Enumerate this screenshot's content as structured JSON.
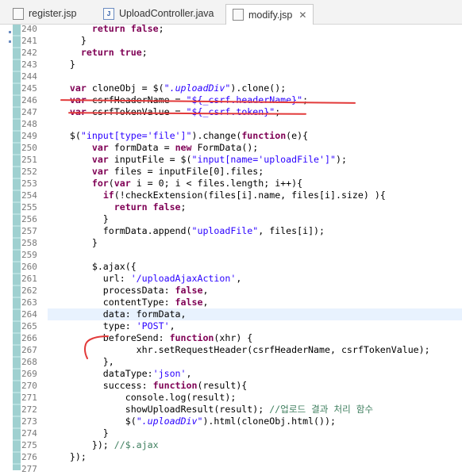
{
  "tabs": [
    {
      "label": "register.jsp",
      "icon": "jsp-file-icon",
      "active": false
    },
    {
      "label": "UploadController.java",
      "icon": "java-file-icon",
      "active": false
    },
    {
      "label": "modify.jsp",
      "icon": "jsp-file-icon",
      "active": true
    }
  ],
  "close_glyph": "✕",
  "colors": {
    "keyword": "#7f0055",
    "string": "#2a00ff",
    "comment": "#3f7f5f",
    "annotation": "#e23a3a",
    "current_line": "#e8f2fe"
  },
  "lines": [
    {
      "n": "240",
      "tokens": [
        [
          "",
          "        "
        ],
        [
          "kw",
          "return"
        ],
        [
          "",
          " "
        ],
        [
          "kw",
          "false"
        ],
        [
          "",
          ";"
        ]
      ]
    },
    {
      "n": "241",
      "tokens": [
        [
          "",
          "      }"
        ]
      ]
    },
    {
      "n": "242",
      "tokens": [
        [
          "",
          "      "
        ],
        [
          "kw",
          "return"
        ],
        [
          "",
          " "
        ],
        [
          "kw",
          "true"
        ],
        [
          "",
          ";"
        ]
      ]
    },
    {
      "n": "243",
      "tokens": [
        [
          "",
          "    }"
        ]
      ]
    },
    {
      "n": "244",
      "tokens": [
        [
          "",
          ""
        ]
      ]
    },
    {
      "n": "245",
      "tokens": [
        [
          "",
          "    "
        ],
        [
          "kw",
          "var"
        ],
        [
          "",
          " cloneObj = $("
        ],
        [
          "sel",
          "\".uploadDiv\""
        ],
        [
          "",
          ").clone();"
        ]
      ]
    },
    {
      "n": "246",
      "tokens": [
        [
          "",
          "    "
        ],
        [
          "kw",
          "var"
        ],
        [
          "",
          " csrfHeaderName = "
        ],
        [
          "str",
          "\"${_csrf.headerName}\""
        ],
        [
          "",
          ";"
        ]
      ]
    },
    {
      "n": "247",
      "tokens": [
        [
          "",
          "    "
        ],
        [
          "kw",
          "var"
        ],
        [
          "",
          " csrfTokenValue = "
        ],
        [
          "str",
          "\"${_csrf.token}\""
        ],
        [
          "",
          ";"
        ]
      ]
    },
    {
      "n": "248",
      "tokens": [
        [
          "",
          ""
        ]
      ]
    },
    {
      "n": "249",
      "tokens": [
        [
          "",
          "    $("
        ],
        [
          "str",
          "\"input[type='file']\""
        ],
        [
          "",
          ").change("
        ],
        [
          "kw",
          "function"
        ],
        [
          "",
          "(e){"
        ]
      ]
    },
    {
      "n": "250",
      "tokens": [
        [
          "",
          "        "
        ],
        [
          "kw",
          "var"
        ],
        [
          "",
          " formData = "
        ],
        [
          "kw",
          "new"
        ],
        [
          "",
          " FormData();"
        ]
      ]
    },
    {
      "n": "251",
      "tokens": [
        [
          "",
          "        "
        ],
        [
          "kw",
          "var"
        ],
        [
          "",
          " inputFile = $("
        ],
        [
          "str",
          "\"input[name='uploadFile']\""
        ],
        [
          "",
          ");"
        ]
      ]
    },
    {
      "n": "252",
      "tokens": [
        [
          "",
          "        "
        ],
        [
          "kw",
          "var"
        ],
        [
          "",
          " files = inputFile[0].files;"
        ]
      ]
    },
    {
      "n": "253",
      "tokens": [
        [
          "",
          "        "
        ],
        [
          "kw",
          "for"
        ],
        [
          "",
          "("
        ],
        [
          "kw",
          "var"
        ],
        [
          "",
          " i = 0; i < files.length; i++){"
        ]
      ]
    },
    {
      "n": "254",
      "tokens": [
        [
          "",
          "          "
        ],
        [
          "kw",
          "if"
        ],
        [
          "",
          "(!checkExtension(files[i].name, files[i].size) ){"
        ]
      ]
    },
    {
      "n": "255",
      "tokens": [
        [
          "",
          "            "
        ],
        [
          "kw",
          "return"
        ],
        [
          "",
          " "
        ],
        [
          "kw",
          "false"
        ],
        [
          "",
          ";"
        ]
      ]
    },
    {
      "n": "256",
      "tokens": [
        [
          "",
          "          }"
        ]
      ]
    },
    {
      "n": "257",
      "tokens": [
        [
          "",
          "          formData.append("
        ],
        [
          "str",
          "\"uploadFile\""
        ],
        [
          "",
          ", files[i]);"
        ]
      ]
    },
    {
      "n": "258",
      "tokens": [
        [
          "",
          "        }"
        ]
      ]
    },
    {
      "n": "259",
      "tokens": [
        [
          "",
          ""
        ]
      ]
    },
    {
      "n": "260",
      "tokens": [
        [
          "",
          "        $.ajax({"
        ]
      ]
    },
    {
      "n": "261",
      "tokens": [
        [
          "",
          "          url: "
        ],
        [
          "str",
          "'/uploadAjaxAction'"
        ],
        [
          "",
          ","
        ]
      ]
    },
    {
      "n": "262",
      "tokens": [
        [
          "",
          "          processData: "
        ],
        [
          "kw",
          "false"
        ],
        [
          "",
          ","
        ]
      ]
    },
    {
      "n": "263",
      "tokens": [
        [
          "",
          "          contentType: "
        ],
        [
          "kw",
          "false"
        ],
        [
          "",
          ","
        ]
      ]
    },
    {
      "n": "264",
      "tokens": [
        [
          "",
          "          data: formData,"
        ]
      ],
      "current": true
    },
    {
      "n": "265",
      "tokens": [
        [
          "",
          "          type: "
        ],
        [
          "str",
          "'POST'"
        ],
        [
          "",
          ","
        ]
      ]
    },
    {
      "n": "266",
      "tokens": [
        [
          "",
          "          beforeSend: "
        ],
        [
          "kw",
          "function"
        ],
        [
          "",
          "(xhr) {"
        ]
      ]
    },
    {
      "n": "267",
      "tokens": [
        [
          "",
          "                xhr.setRequestHeader(csrfHeaderName, csrfTokenValue);"
        ]
      ]
    },
    {
      "n": "268",
      "tokens": [
        [
          "",
          "          },"
        ]
      ]
    },
    {
      "n": "269",
      "tokens": [
        [
          "",
          "          dataType:"
        ],
        [
          "str",
          "'json'"
        ],
        [
          "",
          ","
        ]
      ]
    },
    {
      "n": "270",
      "tokens": [
        [
          "",
          "          success: "
        ],
        [
          "kw",
          "function"
        ],
        [
          "",
          "(result){"
        ]
      ]
    },
    {
      "n": "271",
      "tokens": [
        [
          "",
          "              console.log(result);"
        ]
      ]
    },
    {
      "n": "272",
      "tokens": [
        [
          "",
          "              showUploadResult(result); "
        ],
        [
          "cmt",
          "//업로드 결과 처리 함수"
        ]
      ]
    },
    {
      "n": "273",
      "tokens": [
        [
          "",
          "              $("
        ],
        [
          "sel",
          "\".uploadDiv\""
        ],
        [
          "",
          ").html(cloneObj.html());"
        ]
      ]
    },
    {
      "n": "274",
      "tokens": [
        [
          "",
          "          }"
        ]
      ]
    },
    {
      "n": "275",
      "tokens": [
        [
          "",
          "        }); "
        ],
        [
          "cmt",
          "//$.ajax"
        ]
      ]
    },
    {
      "n": "276",
      "tokens": [
        [
          "",
          "    });"
        ]
      ]
    },
    {
      "n": "277",
      "tokens": [
        [
          "",
          ""
        ]
      ]
    }
  ]
}
